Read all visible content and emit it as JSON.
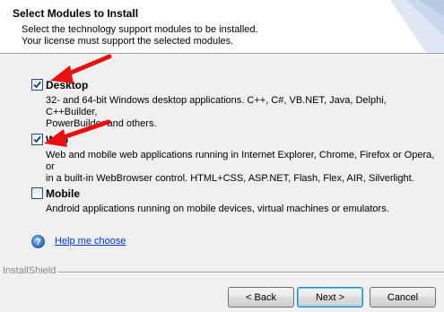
{
  "header": {
    "title": "Select Modules to Install",
    "subtitle_line1": "Select the technology support modules to be installed.",
    "subtitle_line2": "Your license must support the selected modules."
  },
  "modules": [
    {
      "name": "Desktop",
      "checked": true,
      "desc_line1": "32- and 64-bit Windows desktop applications. C++, C#, VB.NET, Java, Delphi, C++Builder,",
      "desc_line2": "PowerBuilder and others."
    },
    {
      "name": "Web",
      "checked": true,
      "desc_line1": "Web and mobile web applications running in Internet Explorer, Chrome, Firefox or Opera, or",
      "desc_line2": "in a built-in WebBrowser control. HTML+CSS, ASP.NET, Flash, Flex, AIR, Silverlight."
    },
    {
      "name": "Mobile",
      "checked": false,
      "desc_line1": "Android applications running on mobile devices, virtual machines or emulators."
    }
  ],
  "help": {
    "link_label": "Help me choose",
    "icon": "question-icon"
  },
  "footer": {
    "brand": "InstallShield",
    "back_label": "< Back",
    "next_label": "Next >",
    "cancel_label": "Cancel"
  },
  "annotations": {
    "arrow_color": "#e81010"
  }
}
